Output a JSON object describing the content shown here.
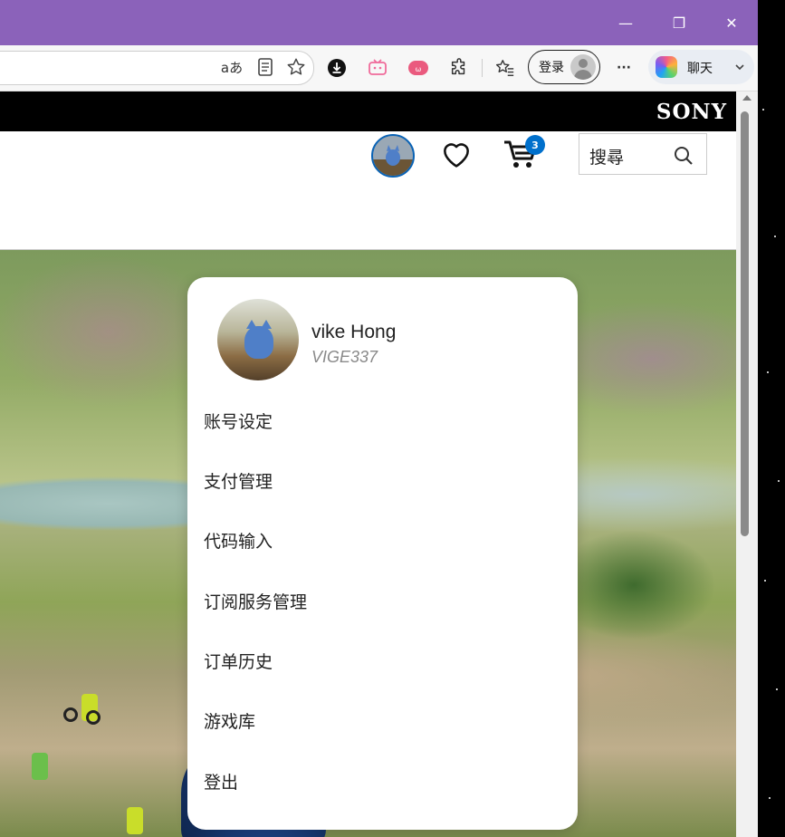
{
  "window": {
    "minimize": "—",
    "restore": "❐",
    "close": "✕"
  },
  "toolbar": {
    "read_aloud_icon": "aあ",
    "login_label": "登录",
    "chat_label": "聊天",
    "more_label": "···"
  },
  "site": {
    "brand": "SONY",
    "cart_count": "3",
    "search_label": "搜尋"
  },
  "user_menu": {
    "display_name": "vike Hong",
    "online_id": "VIGE337",
    "items": [
      {
        "label": "账号设定"
      },
      {
        "label": "支付管理"
      },
      {
        "label": "代码输入"
      },
      {
        "label": "订阅服务管理"
      },
      {
        "label": "订单历史"
      },
      {
        "label": "游戏库"
      },
      {
        "label": "登出"
      }
    ]
  }
}
